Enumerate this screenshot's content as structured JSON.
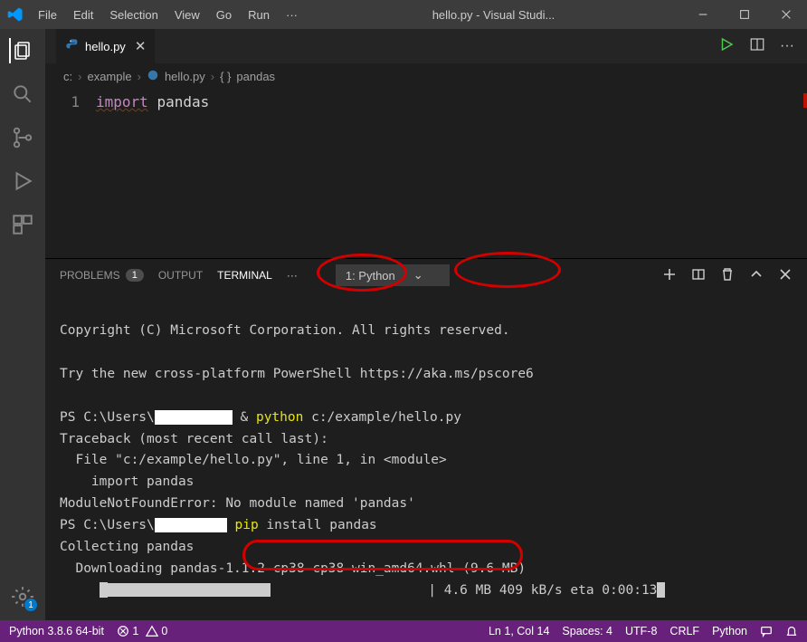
{
  "window": {
    "title": "hello.py - Visual Studi..."
  },
  "menubar": {
    "file": "File",
    "edit": "Edit",
    "selection": "Selection",
    "view": "View",
    "go": "Go",
    "run": "Run",
    "more": "···"
  },
  "activity": {
    "settings_badge": "1"
  },
  "editor": {
    "tab": {
      "name": "hello.py"
    },
    "breadcrumb": {
      "p1": "c:",
      "p2": "example",
      "p3": "hello.py",
      "p4": "pandas"
    },
    "line_no": "1",
    "code_kw": "import",
    "code_mod": "pandas"
  },
  "panel": {
    "problems": "PROBLEMS",
    "problems_count": "1",
    "output": "OUTPUT",
    "terminal": "TERMINAL",
    "dots": "···",
    "term_select": "1: Python"
  },
  "terminal": {
    "l1": "Copyright (C) Microsoft Corporation. All rights reserved.",
    "l2": "Try the new cross-platform PowerShell https://aka.ms/pscore6",
    "l3a": "PS C:\\Users\\",
    "l3b": " & ",
    "l3c": "python",
    "l3d": " c:/example/hello.py",
    "l4": "Traceback (most recent call last):",
    "l5": "  File \"c:/example/hello.py\", line 1, in <module>",
    "l6": "    import pandas",
    "l7": "ModuleNotFoundError: No module named 'pandas'",
    "l8a": "PS C:\\Users\\",
    "l8b": " ",
    "l8c": "pip",
    "l8d": " install pandas",
    "l9": "Collecting pandas",
    "l10": "  Downloading pandas-1.1.2-cp38-cp38-win_amd64.whl (9.6 MB)",
    "l11a": "     ",
    "l11b": "                    | 4.6 MB 409 kB/s eta 0:00:13"
  },
  "status": {
    "interpreter": "Python 3.8.6 64-bit",
    "errors": "1",
    "warnings": "0",
    "cursor": "Ln 1, Col 14",
    "spaces": "Spaces: 4",
    "encoding": "UTF-8",
    "eol": "CRLF",
    "lang": "Python"
  }
}
